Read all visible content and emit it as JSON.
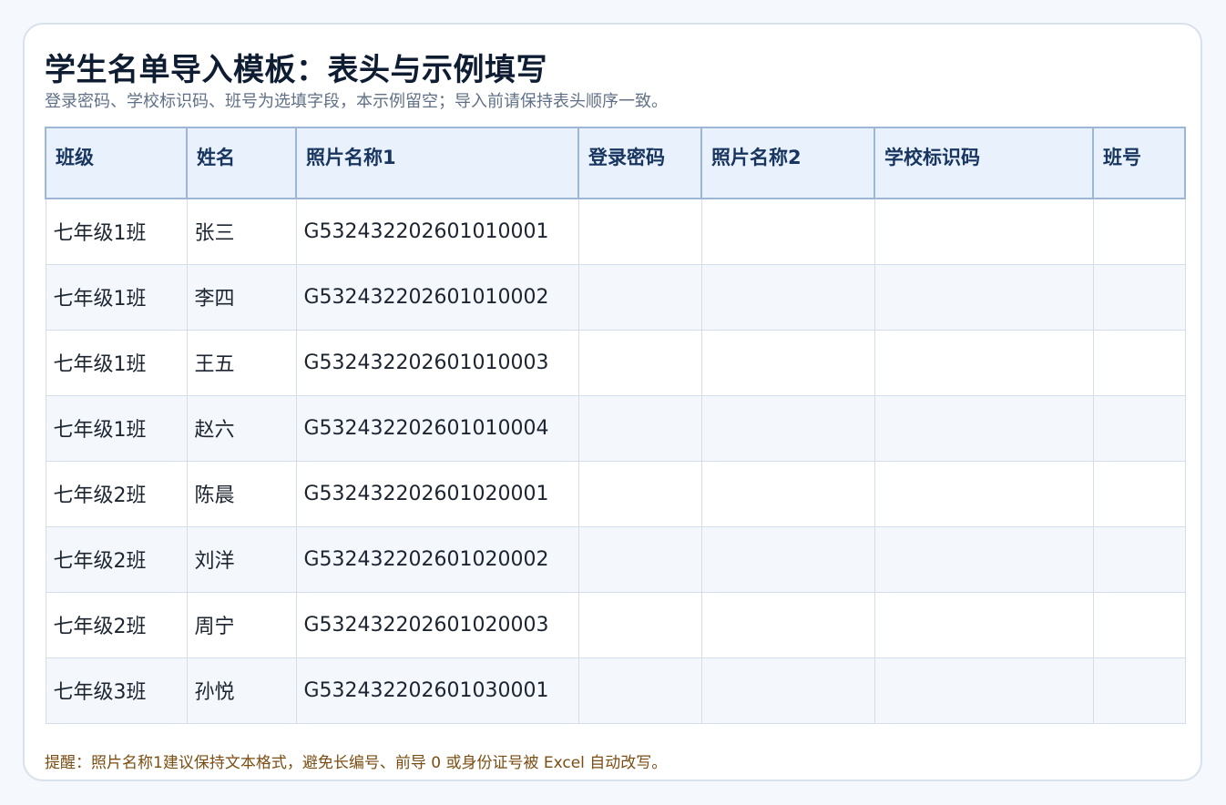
{
  "title": "学生名单导入模板：表头与示例填写",
  "subtitle": "登录密码、学校标识码、班号为选填字段，本示例留空；导入前请保持表头顺序一致。",
  "table": {
    "headers": [
      "班级",
      "姓名",
      "照片名称1",
      "登录密码",
      "照片名称2",
      "学校标识码",
      "班号"
    ],
    "rows": [
      [
        "七年级1班",
        "张三",
        "G532432202601010001",
        "",
        "",
        "",
        ""
      ],
      [
        "七年级1班",
        "李四",
        "G532432202601010002",
        "",
        "",
        "",
        ""
      ],
      [
        "七年级1班",
        "王五",
        "G532432202601010003",
        "",
        "",
        "",
        ""
      ],
      [
        "七年级1班",
        "赵六",
        "G532432202601010004",
        "",
        "",
        "",
        ""
      ],
      [
        "七年级2班",
        "陈晨",
        "G532432202601020001",
        "",
        "",
        "",
        ""
      ],
      [
        "七年级2班",
        "刘洋",
        "G532432202601020002",
        "",
        "",
        "",
        ""
      ],
      [
        "七年级2班",
        "周宁",
        "G532432202601020003",
        "",
        "",
        "",
        ""
      ],
      [
        "七年级3班",
        "孙悦",
        "G532432202601030001",
        "",
        "",
        "",
        ""
      ]
    ]
  },
  "note": "提醒：照片名称1建议保持文本格式，避免长编号、前导 0 或身份证号被 Excel 自动改写。",
  "colors": {
    "header_bg": "#e9f1fd",
    "header_text": "#17355e",
    "note_text": "#7b4d12"
  }
}
